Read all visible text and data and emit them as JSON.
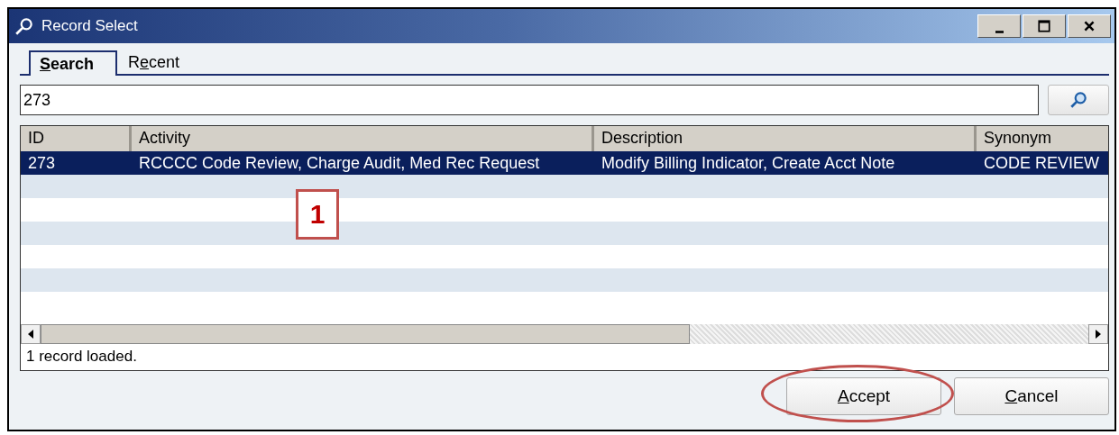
{
  "window": {
    "title": "Record Select"
  },
  "tabs": [
    {
      "key": "S",
      "post": "earch",
      "selected": true
    },
    {
      "pre": "R",
      "key": "e",
      "post": "cent",
      "selected": false
    }
  ],
  "search": {
    "value": "273"
  },
  "table": {
    "columns": [
      "ID",
      "Activity",
      "Description",
      "Synonym"
    ],
    "rows": [
      {
        "cells": [
          "273",
          "RCCCC Code Review, Charge Audit, Med Rec Request",
          "Modify Billing Indicator, Create Acct Note",
          "CODE REVIEW"
        ],
        "selected": true
      }
    ]
  },
  "status_bar": "1 record loaded.",
  "buttons": [
    {
      "key": "A",
      "post": "ccept",
      "highlighted": true
    },
    {
      "key": "C",
      "post": "ancel",
      "highlighted": false
    }
  ],
  "callout": {
    "text": "1"
  }
}
